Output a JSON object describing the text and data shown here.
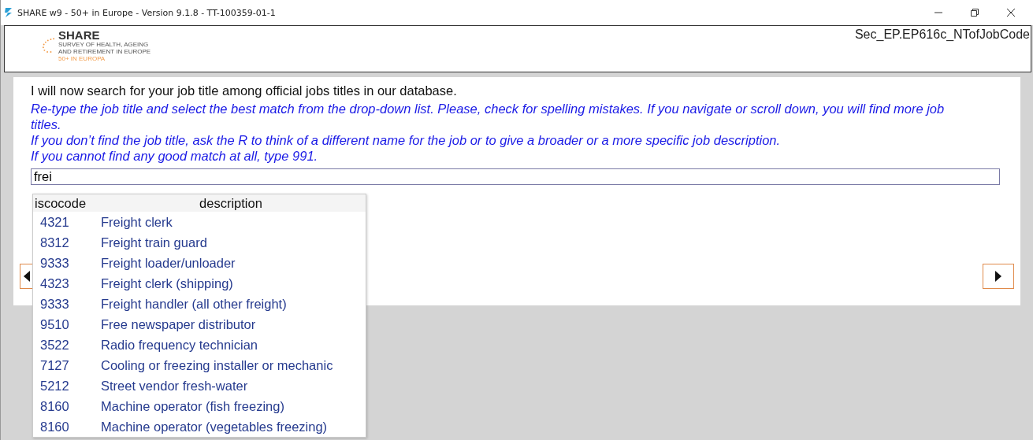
{
  "window": {
    "title": "SHARE w9 - 50+ in Europe - Version 9.1.8 - TT-100359-01-1"
  },
  "header": {
    "logo": {
      "name": "SHARE",
      "lines": [
        "SURVEY OF HEALTH, AGEING",
        "AND RETIREMENT IN EUROPE",
        "50+ IN EUROPA"
      ]
    },
    "question_id": "Sec_EP.EP616c_NTofJobCode"
  },
  "question": {
    "text": "I will now search for your job title among official jobs titles in our database.",
    "instructions": [
      "Re-type the job title and select the best match from the drop-down list. Please, check for spelling mistakes. If you navigate or scroll down, you will find more job titles.",
      "If you don’t find the job title, ask the R to think of a different name for the job or to give a broader or a more specific job description.",
      "If you cannot find any good match at all, type 991."
    ]
  },
  "answer": {
    "value": "frei"
  },
  "dropdown": {
    "columns": [
      "iscocode",
      "description"
    ],
    "rows": [
      {
        "code": "4321",
        "description": "Freight clerk"
      },
      {
        "code": "8312",
        "description": "Freight train guard"
      },
      {
        "code": "9333",
        "description": "Freight loader/unloader"
      },
      {
        "code": "4323",
        "description": "Freight clerk (shipping)"
      },
      {
        "code": "9333",
        "description": "Freight handler (all other freight)"
      },
      {
        "code": "9510",
        "description": "Free newspaper distributor"
      },
      {
        "code": "3522",
        "description": "Radio frequency technician"
      },
      {
        "code": "7127",
        "description": "Cooling or freezing installer or mechanic"
      },
      {
        "code": "5212",
        "description": "Street vendor fresh-water"
      },
      {
        "code": "8160",
        "description": "Machine operator (fish freezing)"
      },
      {
        "code": "8160",
        "description": "Machine operator (vegetables freezing)"
      }
    ]
  }
}
